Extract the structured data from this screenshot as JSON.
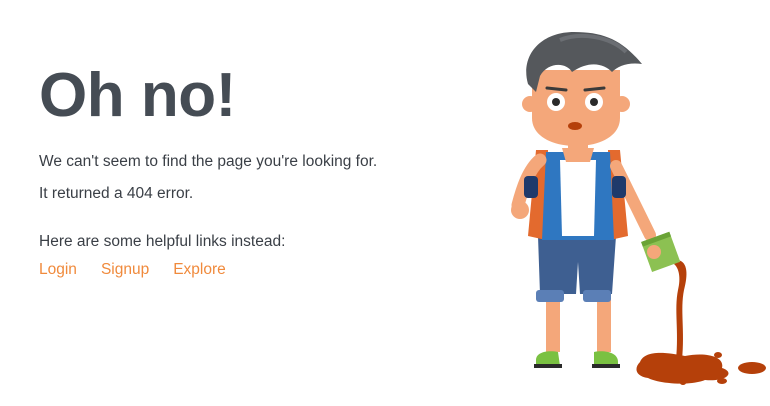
{
  "page": {
    "title": "Oh no!",
    "message": "We can't seem to find the page you're looking for.",
    "error_text": "It returned a 404 error.",
    "helpful_text": "Here are some helpful links instead:"
  },
  "links": [
    {
      "label": "Login"
    },
    {
      "label": "Signup"
    },
    {
      "label": "Explore"
    }
  ],
  "colors": {
    "link": "#f08a3c",
    "title": "#454c54",
    "spill": "#b5400a"
  },
  "illustration": {
    "icon": "boy-spilling-cup-illustration"
  }
}
